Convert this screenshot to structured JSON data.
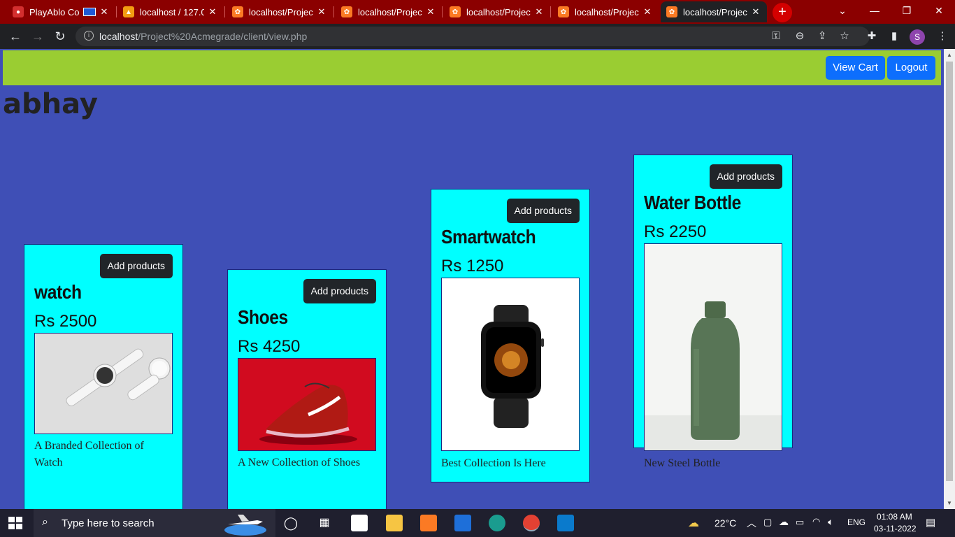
{
  "browser": {
    "tabs": [
      {
        "title": "PlayAblo Co",
        "favicon": "playablo-icon",
        "color": "#d32f2f"
      },
      {
        "title": "localhost / 127.0.",
        "favicon": "phpmyadmin-icon",
        "color": "#f39c12"
      },
      {
        "title": "localhost/Project",
        "favicon": "xampp-icon",
        "color": "#fb7a24"
      },
      {
        "title": "localhost/Project",
        "favicon": "xampp-icon",
        "color": "#fb7a24"
      },
      {
        "title": "localhost/Project",
        "favicon": "xampp-icon",
        "color": "#fb7a24"
      },
      {
        "title": "localhost/Project",
        "favicon": "xampp-icon",
        "color": "#fb7a24"
      },
      {
        "title": "localhost/Project",
        "favicon": "xampp-icon",
        "color": "#fb7a24",
        "active": true
      }
    ],
    "new_tab": "+",
    "url_host": "localhost",
    "url_path": "/Project%20Acmegrade/client/view.php",
    "profile_initial": "S",
    "tab_strip_color": "#8b0000"
  },
  "header": {
    "view_cart_label": "View Cart",
    "logout_label": "Logout",
    "bar_color": "#9acd32"
  },
  "user": {
    "name": "abhay"
  },
  "products": [
    {
      "name": "watch",
      "price": "Rs 2500",
      "description": "A Branded Collection of Watch",
      "button": "Add products",
      "image": "white-smartwatch-photo"
    },
    {
      "name": "Shoes",
      "price": "Rs 4250",
      "description": "A New Collection of Shoes",
      "button": "Add products",
      "image": "red-sneaker-photo"
    },
    {
      "name": "Smartwatch",
      "price": "Rs 1250",
      "description": "Best Collection Is Here",
      "button": "Add products",
      "image": "black-smartwatch-photo"
    },
    {
      "name": "Water Bottle",
      "price": "Rs 2250",
      "description": "New Steel Bottle",
      "button": "Add products",
      "image": "green-bottle-photo"
    }
  ],
  "taskbar": {
    "search_placeholder": "Type here to search",
    "weather": "22°C",
    "language": "ENG",
    "time": "01:08 AM",
    "date": "03-11-2022"
  }
}
